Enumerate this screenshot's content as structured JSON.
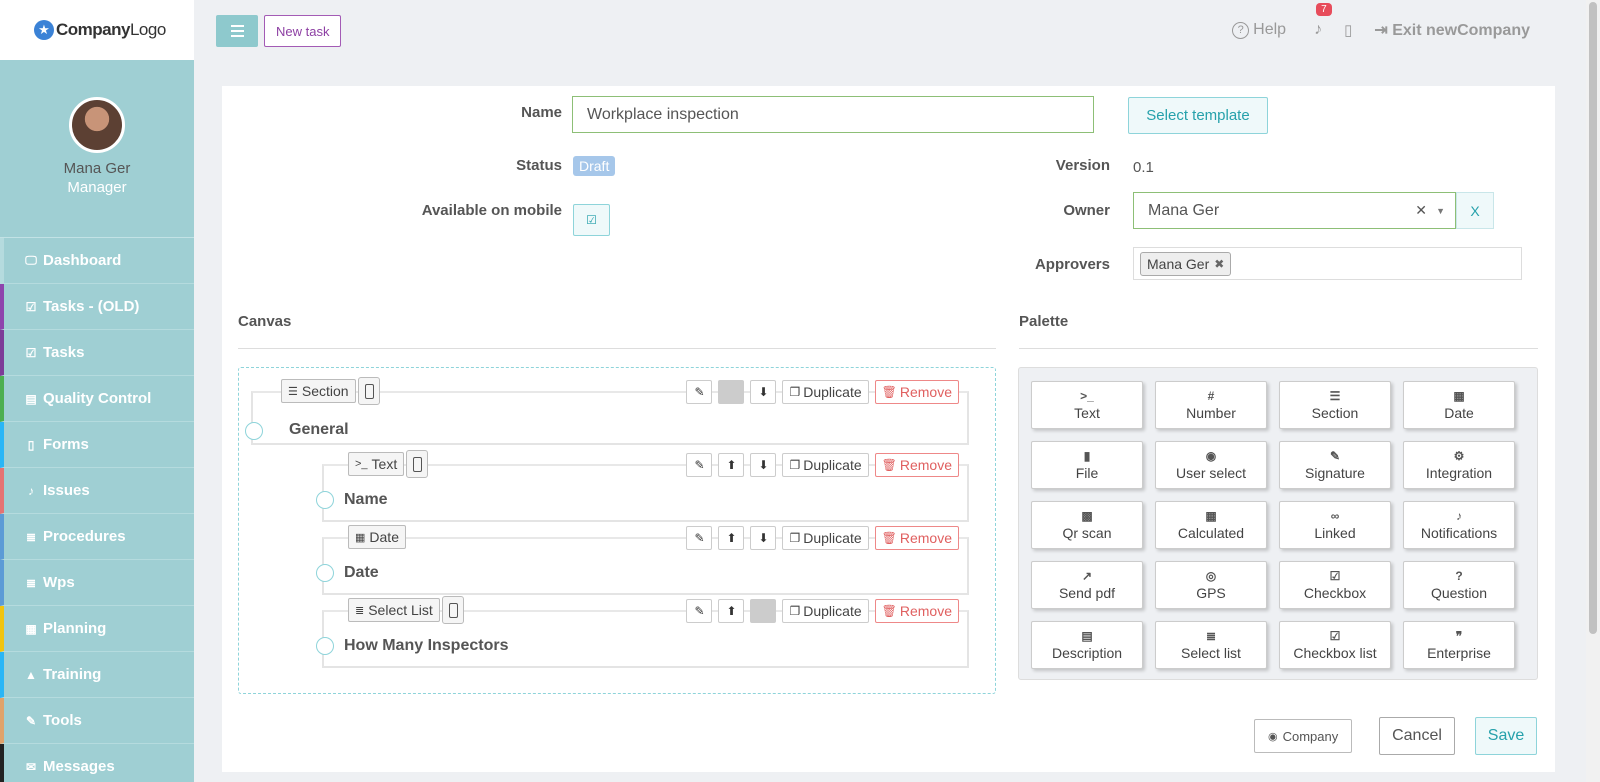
{
  "logo": {
    "text_bold": "Company",
    "text_light": "Logo"
  },
  "profile": {
    "name": "Mana Ger",
    "role": "Manager"
  },
  "nav": [
    {
      "label": "Dashboard",
      "icon": "monitor-icon",
      "glyph": "🖵",
      "color": "#b5dbde"
    },
    {
      "label": "Tasks - (OLD)",
      "icon": "check-square-icon",
      "glyph": "☑",
      "color": "#8e44ad"
    },
    {
      "label": "Tasks",
      "icon": "check-square-icon",
      "glyph": "☑",
      "color": "#7d3c98"
    },
    {
      "label": "Quality Control",
      "icon": "book-icon",
      "glyph": "▤",
      "color": "#4caf50"
    },
    {
      "label": "Forms",
      "icon": "file-icon",
      "glyph": "▯",
      "color": "#29b6f6"
    },
    {
      "label": "Issues",
      "icon": "bell-icon",
      "glyph": "♪",
      "color": "#e57373"
    },
    {
      "label": "Procedures",
      "icon": "list-icon",
      "glyph": "≣",
      "color": "#5c9bd6"
    },
    {
      "label": "Wps",
      "icon": "list-icon",
      "glyph": "≣",
      "color": "#5c9bd6"
    },
    {
      "label": "Planning",
      "icon": "calendar-check-icon",
      "glyph": "▦",
      "color": "#f1c40f"
    },
    {
      "label": "Training",
      "icon": "graduation-cap-icon",
      "glyph": "▲",
      "color": "#29b6f6"
    },
    {
      "label": "Tools",
      "icon": "wrench-icon",
      "glyph": "✎",
      "color": "#e0a36b"
    },
    {
      "label": "Messages",
      "icon": "envelope-icon",
      "glyph": "✉",
      "color": "#222"
    }
  ],
  "topbar": {
    "new_task": "New task",
    "help": "Help",
    "notifications": "7",
    "exit": "Exit newCompany"
  },
  "form": {
    "name_label": "Name",
    "name_value": "Workplace inspection",
    "select_template": "Select template",
    "status_label": "Status",
    "status_value": "Draft",
    "version_label": "Version",
    "version_value": "0.1",
    "mobile_label": "Available on mobile",
    "owner_label": "Owner",
    "owner_value": "Mana Ger",
    "owner_clear": "X",
    "approvers_label": "Approvers",
    "approvers": [
      "Mana Ger"
    ]
  },
  "canvas": {
    "title": "Canvas",
    "duplicate": "Duplicate",
    "remove": "Remove",
    "items": [
      {
        "type": "Section",
        "name": "General"
      },
      {
        "type": "Text",
        "name": "Name"
      },
      {
        "type": "Date",
        "name": "Date"
      },
      {
        "type": "Select List",
        "name": "How Many Inspectors"
      }
    ]
  },
  "palette": {
    "title": "Palette",
    "items": [
      {
        "label": "Text",
        "icon": "terminal-icon",
        "glyph": ">_"
      },
      {
        "label": "Number",
        "icon": "hash-icon",
        "glyph": "#"
      },
      {
        "label": "Section",
        "icon": "indent-icon",
        "glyph": "☰"
      },
      {
        "label": "Date",
        "icon": "calendar-icon",
        "glyph": "▦"
      },
      {
        "label": "File",
        "icon": "file-icon",
        "glyph": "▮"
      },
      {
        "label": "User select",
        "icon": "user-circle-icon",
        "glyph": "◉"
      },
      {
        "label": "Signature",
        "icon": "signature-icon",
        "glyph": "✎"
      },
      {
        "label": "Integration",
        "icon": "cogs-icon",
        "glyph": "⚙"
      },
      {
        "label": "Qr scan",
        "icon": "qrcode-icon",
        "glyph": "▩"
      },
      {
        "label": "Calculated",
        "icon": "calculator-icon",
        "glyph": "▦"
      },
      {
        "label": "Linked",
        "icon": "link-icon",
        "glyph": "∞"
      },
      {
        "label": "Notifications",
        "icon": "bell-icon",
        "glyph": "♪"
      },
      {
        "label": "Send pdf",
        "icon": "share-icon",
        "glyph": "↗"
      },
      {
        "label": "GPS",
        "icon": "compass-icon",
        "glyph": "◎"
      },
      {
        "label": "Checkbox",
        "icon": "check-square-icon",
        "glyph": "☑"
      },
      {
        "label": "Question",
        "icon": "question-circle-icon",
        "glyph": "?"
      },
      {
        "label": "Description",
        "icon": "file-text-icon",
        "glyph": "▤"
      },
      {
        "label": "Select list",
        "icon": "list-ol-icon",
        "glyph": "≣"
      },
      {
        "label": "Checkbox list",
        "icon": "check-square-icon",
        "glyph": "☑"
      },
      {
        "label": "Enterprise",
        "icon": "quote-icon",
        "glyph": "❞"
      }
    ]
  },
  "footer": {
    "company": "Company",
    "cancel": "Cancel",
    "save": "Save"
  }
}
